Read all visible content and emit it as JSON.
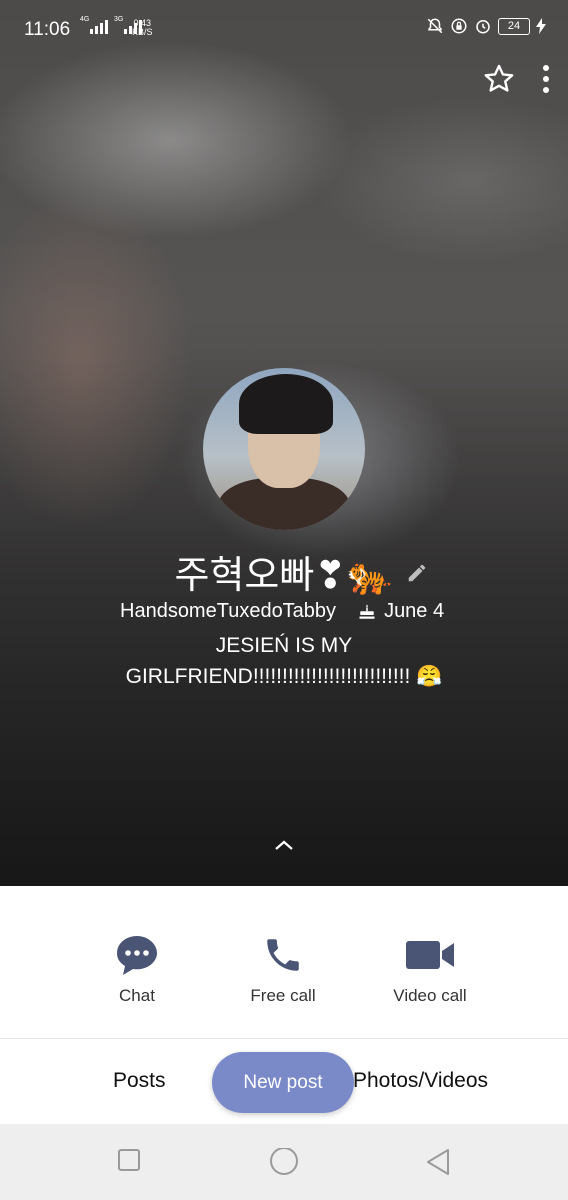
{
  "status_bar": {
    "time": "11:06",
    "signal1_label": "4G",
    "signal2_label": "3G",
    "net_speed_value": "0.43",
    "net_speed_unit": "KB/S",
    "battery": "24"
  },
  "profile": {
    "name": "주혁오빠",
    "name_emojis": "❣🐅",
    "username": "HandsomeTuxedoTabby",
    "birthday": "June 4",
    "status_line1": "JESIEŃ IS MY",
    "status_line2": "GIRLFRIEND!!!!!!!!!!!!!!!!!!!!!!!!!!! 😤"
  },
  "actions": {
    "chat_label": "Chat",
    "free_call_label": "Free call",
    "video_call_label": "Video call"
  },
  "tabs": {
    "posts_label": "Posts",
    "photos_label": "Photos/Videos",
    "new_post_label": "New post"
  },
  "colors": {
    "accent": "#7a89c8",
    "icon_dark": "#4a5575"
  },
  "icons": [
    "star-icon",
    "more-vert-icon",
    "pencil-icon",
    "cake-icon",
    "chevron-up-icon",
    "chat-bubble-icon",
    "phone-icon",
    "video-camera-icon",
    "square-nav-icon",
    "circle-nav-icon",
    "triangle-back-icon"
  ]
}
